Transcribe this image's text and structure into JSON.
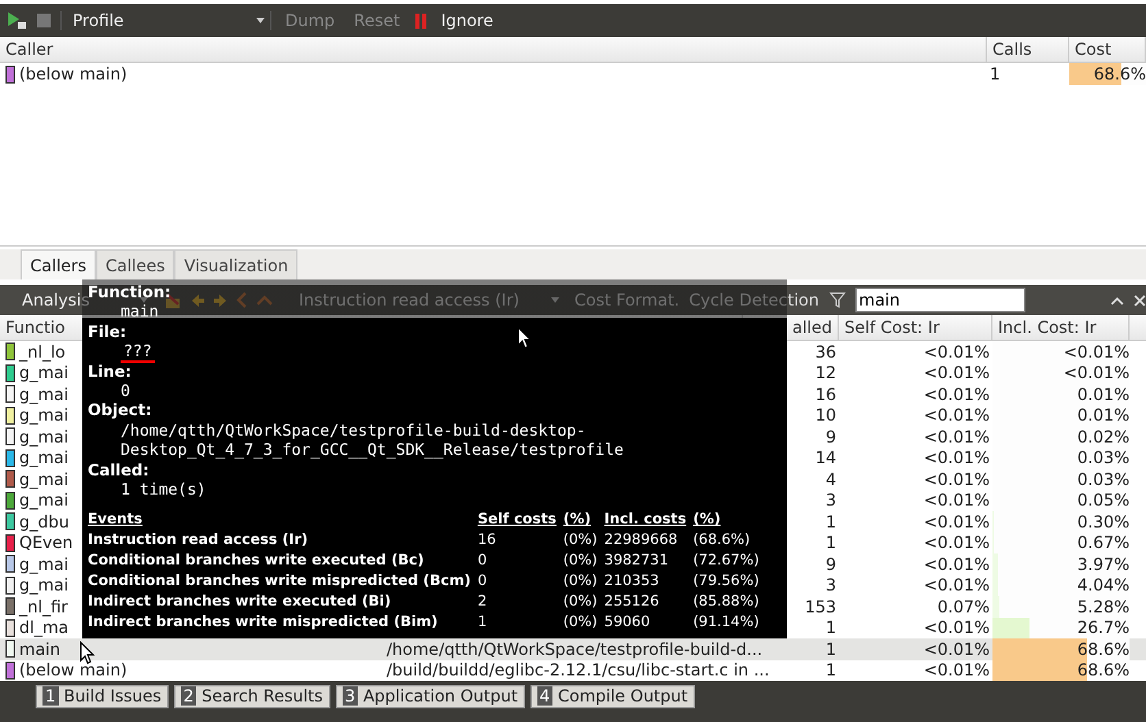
{
  "toolbar": {
    "profile": "Profile",
    "dump": {
      "label": "Dump",
      "disabled": true
    },
    "reset": {
      "label": "Reset",
      "disabled": true
    },
    "ignore": "Ignore"
  },
  "callers": {
    "columns": [
      "Caller",
      "Calls",
      "Cost"
    ],
    "rows": [
      {
        "name": "(below main)",
        "color": "#c070d8",
        "calls": "1",
        "cost": "68.6%",
        "level": 0.686
      }
    ]
  },
  "tabs": [
    {
      "label": "Callers",
      "selected": true
    },
    {
      "label": "Callees",
      "selected": false
    },
    {
      "label": "Visualization",
      "selected": false
    }
  ],
  "analysis": {
    "combo": "Analysis",
    "event": "Instruction read access (Ir)",
    "cost_format": "Cost Format.",
    "cycle_detection": "Cycle Detection",
    "filter": "main"
  },
  "functions": {
    "columns": [
      "Functio",
      "alled",
      "Self Cost: Ir",
      "Incl. Cost: Ir"
    ],
    "rows": [
      {
        "name": "_nl_lo",
        "color": "#8fc43a",
        "called": "36",
        "self": "<0.01%",
        "incl": "<0.01%",
        "selected": false
      },
      {
        "name": "g_mai",
        "color": "#2ecc8f",
        "called": "12",
        "self": "<0.01%",
        "incl": "<0.01%",
        "selected": false
      },
      {
        "name": "g_mai",
        "color": "#f5f5f5",
        "called": "16",
        "self": "<0.01%",
        "incl": "0.01%",
        "selected": false
      },
      {
        "name": "g_mai",
        "color": "#f0f0a0",
        "called": "10",
        "self": "<0.01%",
        "incl": "0.01%",
        "selected": false
      },
      {
        "name": "g_mai",
        "color": "#f4f4f4",
        "called": "9",
        "self": "<0.01%",
        "incl": "0.02%",
        "selected": false
      },
      {
        "name": "g_mai",
        "color": "#2ab8e8",
        "called": "14",
        "self": "<0.01%",
        "incl": "0.03%",
        "selected": false
      },
      {
        "name": "g_mai",
        "color": "#b05a4a",
        "called": "4",
        "self": "<0.01%",
        "incl": "0.03%",
        "selected": false
      },
      {
        "name": "g_mai",
        "color": "#4ca83a",
        "called": "3",
        "self": "<0.01%",
        "incl": "0.05%",
        "selected": false
      },
      {
        "name": "g_dbu",
        "color": "#3cc8a0",
        "called": "1",
        "self": "<0.01%",
        "incl": "0.30%",
        "level": 0.003,
        "selected": false
      },
      {
        "name": "QEven",
        "color": "#e8204a",
        "called": "1",
        "self": "<0.01%",
        "incl": "0.67%",
        "level": 0.007,
        "selected": false
      },
      {
        "name": "g_mai",
        "color": "#b8c8e8",
        "called": "9",
        "self": "<0.01%",
        "incl": "3.97%",
        "level": 0.04,
        "selected": false
      },
      {
        "name": "g_mai",
        "color": "#f0f0f0",
        "called": "3",
        "self": "<0.01%",
        "incl": "4.04%",
        "level": 0.04,
        "selected": false
      },
      {
        "name": "_nl_fir",
        "color": "#7a7068",
        "called": "153",
        "self": "0.07%",
        "incl": "5.28%",
        "level": 0.053,
        "selected": false
      },
      {
        "name": "dl_ma",
        "color": "#e8e0dc",
        "called": "1",
        "self": "<0.01%",
        "incl": "26.7%",
        "level": 0.267,
        "selected": false
      },
      {
        "name": "main",
        "color": "#f0f8f0",
        "location": "/home/qtth/QtWorkSpace/testprofile-build-d...",
        "called": "1",
        "self": "<0.01%",
        "incl": "68.6%",
        "level": 0.686,
        "selected": true
      },
      {
        "name": "(below main)",
        "color": "#c070d8",
        "location": "/build/buildd/eglibc-2.12.1/csu/libc-start.c in ...",
        "called": "1",
        "self": "<0.01%",
        "incl": "68.6%",
        "level": 0.686,
        "selected": false
      }
    ]
  },
  "tooltip": {
    "function_label": "Function:",
    "function": "main",
    "file_label": "File:",
    "file": "???",
    "line_label": "Line:",
    "line": "0",
    "object_label": "Object:",
    "object": [
      "/home/qtth/QtWorkSpace/testprofile-build-desktop-",
      "Desktop_Qt_4_7_3_for_GCC__Qt_SDK__Release/testprofile"
    ],
    "called_label": "Called:",
    "called": "1 time(s)",
    "event_columns": [
      "Events",
      "Self costs",
      "(%)",
      "Incl. costs",
      "(%)"
    ],
    "events": [
      {
        "name": "Instruction read access (Ir)",
        "self": "16",
        "self_pct": "(0%)",
        "incl": "22989668",
        "incl_pct": "(68.6%)"
      },
      {
        "name": "Conditional branches write executed (Bc)",
        "self": "0",
        "self_pct": "(0%)",
        "incl": "3982731",
        "incl_pct": "(72.67%)"
      },
      {
        "name": "Conditional branches write mispredicted (Bcm)",
        "self": "0",
        "self_pct": "(0%)",
        "incl": "210353",
        "incl_pct": "(79.56%)"
      },
      {
        "name": "Indirect branches write executed (Bi)",
        "self": "2",
        "self_pct": "(0%)",
        "incl": "255126",
        "incl_pct": "(85.88%)"
      },
      {
        "name": "Indirect branches write mispredicted (Bim)",
        "self": "1",
        "self_pct": "(0%)",
        "incl": "59060",
        "incl_pct": "(91.14%)"
      }
    ]
  },
  "output_tabs": [
    {
      "number": "1",
      "label": "Build Issues"
    },
    {
      "number": "2",
      "label": "Search Results"
    },
    {
      "number": "3",
      "label": "Application Output"
    },
    {
      "number": "4",
      "label": "Compile Output"
    }
  ]
}
